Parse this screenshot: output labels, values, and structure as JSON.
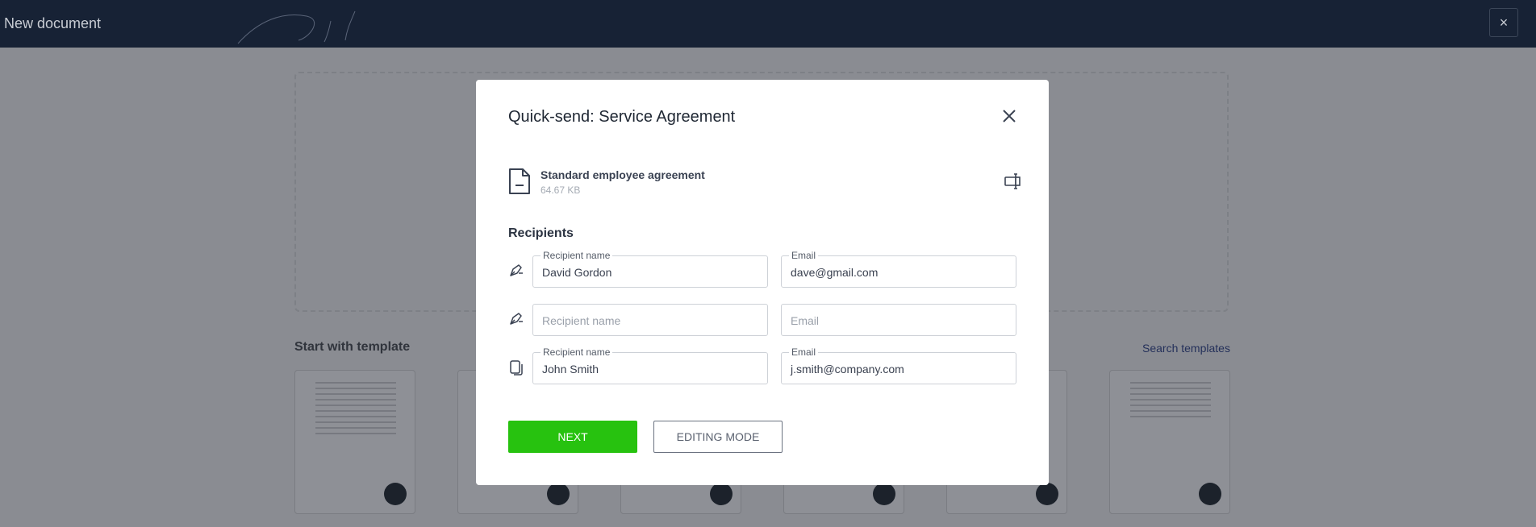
{
  "topbar": {
    "title": "New document",
    "close_glyph": "×"
  },
  "background": {
    "templates_heading": "Start with template",
    "search_templates_link": "Search templates",
    "template_card_count": 6
  },
  "modal": {
    "title": "Quick-send: Service Agreement",
    "file": {
      "name": "Standard employee agreement",
      "size": "64.67 KB"
    },
    "recipients_heading": "Recipients",
    "rows": [
      {
        "icon": "signer-pen-icon",
        "name_label": "Recipient name",
        "name_value": "David Gordon",
        "email_label": "Email",
        "email_value": "dave@gmail.com"
      },
      {
        "icon": "signer-pen-icon",
        "name_placeholder": "Recipient name",
        "email_placeholder": "Email"
      },
      {
        "icon": "copy-recipient-icon",
        "name_label": "Recipient name",
        "name_value": "John Smith",
        "email_label": "Email",
        "email_value": "j.smith@company.com"
      }
    ],
    "buttons": {
      "next": "NEXT",
      "editing_mode": "EDITING MODE"
    }
  }
}
